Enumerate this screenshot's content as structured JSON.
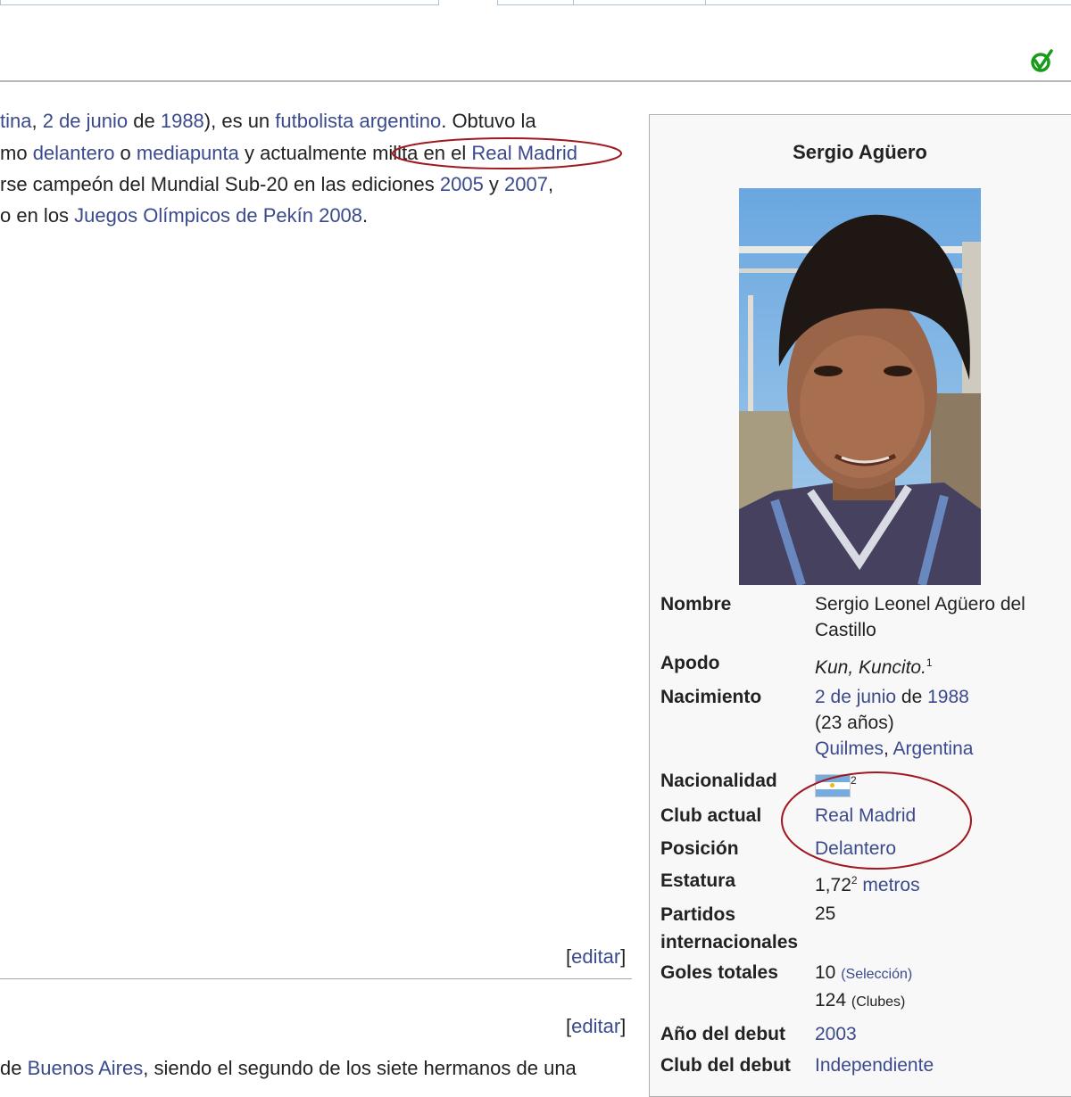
{
  "article": {
    "lines": [
      {
        "parts": [
          {
            "t": "tina",
            "link": true
          },
          {
            "t": ", ",
            "link": false
          },
          {
            "t": "2 de junio",
            "link": true
          },
          {
            "t": " de ",
            "link": false
          },
          {
            "t": "1988",
            "link": true
          },
          {
            "t": "), es un ",
            "link": false
          },
          {
            "t": "futbolista",
            "link": true
          },
          {
            "t": " ",
            "link": false
          },
          {
            "t": "argentino",
            "link": true
          },
          {
            "t": ". Obtuvo la",
            "link": false
          }
        ]
      },
      {
        "parts": [
          {
            "t": "mo ",
            "link": false
          },
          {
            "t": "delantero",
            "link": true
          },
          {
            "t": " o ",
            "link": false
          },
          {
            "t": "mediapunta",
            "link": true
          },
          {
            "t": " y actualmente milita en el ",
            "link": false
          },
          {
            "t": "Real Madrid",
            "link": true
          }
        ]
      },
      {
        "parts": [
          {
            "t": "rse campeón del Mundial Sub-20 en las ediciones ",
            "link": false
          },
          {
            "t": "2005",
            "link": true
          },
          {
            "t": " y ",
            "link": false
          },
          {
            "t": "2007",
            "link": true
          },
          {
            "t": ",",
            "link": false
          }
        ]
      },
      {
        "parts": [
          {
            "t": "o en los ",
            "link": false
          },
          {
            "t": "Juegos Olímpicos de Pekín 2008",
            "link": true
          },
          {
            "t": ".",
            "link": false
          }
        ]
      }
    ],
    "edit_link": "editar",
    "bottom_line": [
      {
        "t": "de ",
        "link": false
      },
      {
        "t": "Buenos Aires",
        "link": true
      },
      {
        "t": ", siendo el segundo de los siete hermanos de una",
        "link": false
      }
    ]
  },
  "infobox": {
    "title": "Sergio Agüero",
    "rows": [
      {
        "label": "Nombre",
        "lines": [
          [
            {
              "t": "Sergio Leonel Agüero del",
              "link": false
            }
          ],
          [
            {
              "t": "Castillo",
              "link": false
            }
          ]
        ]
      },
      {
        "label": "Apodo",
        "lines": [
          [
            {
              "t": "Kun, Kuncito.",
              "link": false,
              "italic": true
            },
            {
              "t": "1",
              "sup": true
            }
          ]
        ]
      },
      {
        "label": "Nacimiento",
        "lines": [
          [
            {
              "t": "2 de junio",
              "link": true
            },
            {
              "t": " de ",
              "link": false
            },
            {
              "t": "1988",
              "link": true
            }
          ],
          [
            {
              "t": "(23 años)",
              "link": false
            }
          ],
          [
            {
              "t": "Quilmes",
              "link": true
            },
            {
              "t": ", ",
              "link": false
            },
            {
              "t": "Argentina",
              "link": true
            }
          ]
        ]
      },
      {
        "label": "Nacionalidad",
        "lines": [
          [
            {
              "t": "",
              "flag": true
            },
            {
              "t": "2",
              "sup": true
            }
          ]
        ]
      },
      {
        "label": "Club actual",
        "lines": [
          [
            {
              "t": "Real Madrid",
              "link": true
            }
          ]
        ]
      },
      {
        "label": "Posición",
        "lines": [
          [
            {
              "t": "Delantero",
              "link": true
            }
          ]
        ]
      },
      {
        "label": "Estatura",
        "lines": [
          [
            {
              "t": "1,72",
              "link": false
            },
            {
              "t": "2",
              "sup": true
            },
            {
              "t": " ",
              "link": false
            },
            {
              "t": "metros",
              "link": true
            }
          ]
        ]
      },
      {
        "label": "Partidos internacionales",
        "lines": [
          [
            {
              "t": "25",
              "link": false
            }
          ]
        ]
      },
      {
        "label": "Goles totales",
        "lines": [
          [
            {
              "t": "10 ",
              "link": false
            },
            {
              "t": "(Selección)",
              "link": true,
              "small": true
            }
          ],
          [
            {
              "t": "124 ",
              "link": false
            },
            {
              "t": "(Clubes)",
              "link": false,
              "small": true
            }
          ]
        ]
      },
      {
        "label": "Año del debut",
        "lines": [
          [
            {
              "t": "2003",
              "link": true
            }
          ]
        ]
      },
      {
        "label": "Club del debut",
        "lines": [
          [
            {
              "t": "Independiente",
              "link": true
            }
          ]
        ]
      }
    ]
  },
  "icons": {
    "check": "check-mark-icon"
  },
  "colors": {
    "link": "#3b4a8c",
    "annotation": "#a01820",
    "infobox_bg": "#f8f8f8"
  }
}
